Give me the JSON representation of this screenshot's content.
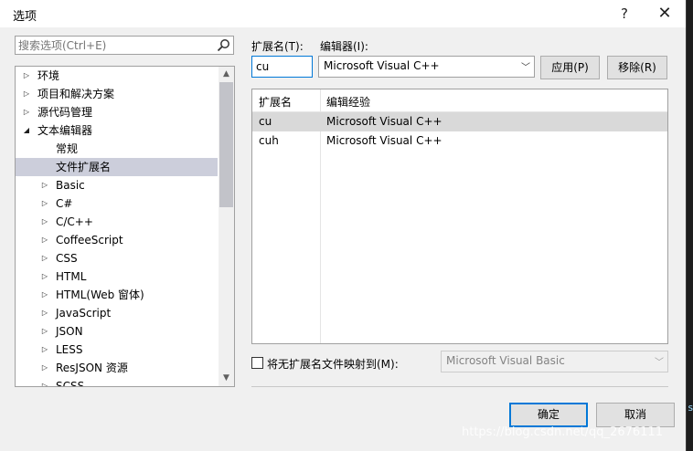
{
  "window": {
    "title": "选项",
    "help_label": "?",
    "close_label": "✕"
  },
  "search": {
    "placeholder": "搜索选项(Ctrl+E)"
  },
  "tree": {
    "items": [
      {
        "label": "环境",
        "level": 0,
        "expander": "collapsed"
      },
      {
        "label": "项目和解决方案",
        "level": 0,
        "expander": "collapsed"
      },
      {
        "label": "源代码管理",
        "level": 0,
        "expander": "collapsed"
      },
      {
        "label": "文本编辑器",
        "level": 0,
        "expander": "expanded"
      },
      {
        "label": "常规",
        "level": 1,
        "expander": "none"
      },
      {
        "label": "文件扩展名",
        "level": 1,
        "expander": "none",
        "selected": true
      },
      {
        "label": "Basic",
        "level": 1,
        "expander": "collapsed"
      },
      {
        "label": "C#",
        "level": 1,
        "expander": "collapsed"
      },
      {
        "label": "C/C++",
        "level": 1,
        "expander": "collapsed"
      },
      {
        "label": "CoffeeScript",
        "level": 1,
        "expander": "collapsed"
      },
      {
        "label": "CSS",
        "level": 1,
        "expander": "collapsed"
      },
      {
        "label": "HTML",
        "level": 1,
        "expander": "collapsed"
      },
      {
        "label": "HTML(Web 窗体)",
        "level": 1,
        "expander": "collapsed"
      },
      {
        "label": "JavaScript",
        "level": 1,
        "expander": "collapsed"
      },
      {
        "label": "JSON",
        "level": 1,
        "expander": "collapsed"
      },
      {
        "label": "LESS",
        "level": 1,
        "expander": "collapsed"
      },
      {
        "label": "ResJSON 资源",
        "level": 1,
        "expander": "collapsed"
      },
      {
        "label": "SCSS",
        "level": 1,
        "expander": "collapsed"
      }
    ]
  },
  "extension": {
    "label": "扩展名(T):",
    "value": "cu"
  },
  "editor": {
    "label": "编辑器(I):",
    "value": "Microsoft Visual C++"
  },
  "buttons": {
    "apply": "应用(P)",
    "remove": "移除(R)",
    "ok": "确定",
    "cancel": "取消"
  },
  "grid": {
    "headers": [
      "扩展名",
      "编辑经验"
    ],
    "rows": [
      {
        "ext": "cu",
        "editor": "Microsoft Visual C++",
        "selected": true
      },
      {
        "ext": "cuh",
        "editor": "Microsoft Visual C++",
        "selected": false
      }
    ]
  },
  "map_no_ext": {
    "label": "将无扩展名文件映射到(M):",
    "checked": false,
    "value": "Microsoft Visual Basic"
  },
  "watermark": "https://blog.csdn.net/qq_2676111"
}
